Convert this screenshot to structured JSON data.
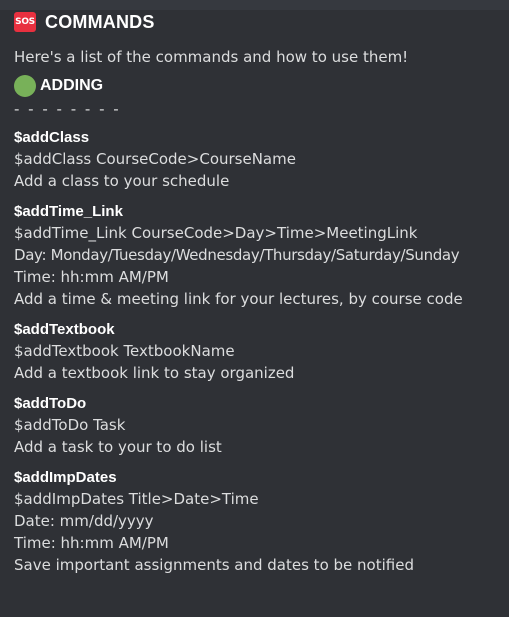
{
  "header": {
    "icon_text": "SOS",
    "title": "COMMANDS"
  },
  "intro": "Here's a list of the commands and how to use them!",
  "section": {
    "title": "ADDING",
    "icon": "green-circle-icon",
    "divider": "- - - - - - - -"
  },
  "commands": [
    {
      "name": "$addClass",
      "lines": [
        "$addClass CourseCode>CourseName",
        "Add a class to your schedule"
      ]
    },
    {
      "name": "$addTime_Link",
      "lines": [
        "$addTime_Link CourseCode>Day>Time>MeetingLink",
        "Day: Monday/Tuesday/Wednesday/Thursday/Saturday/Sunday",
        "Time: hh:mm AM/PM",
        "Add a time & meeting link for your lectures, by course code"
      ]
    },
    {
      "name": "$addTextbook",
      "lines": [
        "$addTextbook TextbookName",
        "Add a textbook link to stay organized"
      ]
    },
    {
      "name": "$addToDo",
      "lines": [
        "$addToDo Task",
        "Add a task to your to do list"
      ]
    },
    {
      "name": "$addImpDates",
      "lines": [
        "$addImpDates Title>Date>Time",
        "Date: mm/dd/yyyy",
        "Time: hh:mm AM/PM",
        "Save important assignments and dates to be notified"
      ]
    }
  ],
  "colors": {
    "background": "#2f3136",
    "text": "#dcddde",
    "heading": "#ffffff",
    "sos_red": "#e8303f",
    "circle_green": "#78b159"
  }
}
